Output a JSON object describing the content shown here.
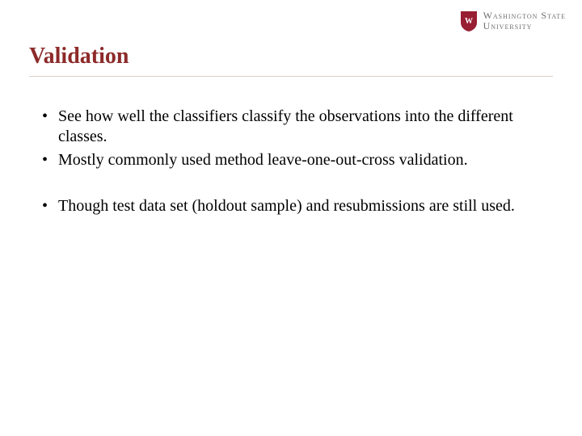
{
  "logo": {
    "line1": "Washington State",
    "line2": "University",
    "shield_color": "#981e32",
    "shield_text_color": "#ffffff"
  },
  "title": "Validation",
  "bullets": {
    "b1": "See how well the classifiers classify the observations into the different classes.",
    "b2": "Mostly commonly used method leave-one-out-cross validation.",
    "b3": "Though test data set (holdout sample) and resubmissions are still used."
  }
}
